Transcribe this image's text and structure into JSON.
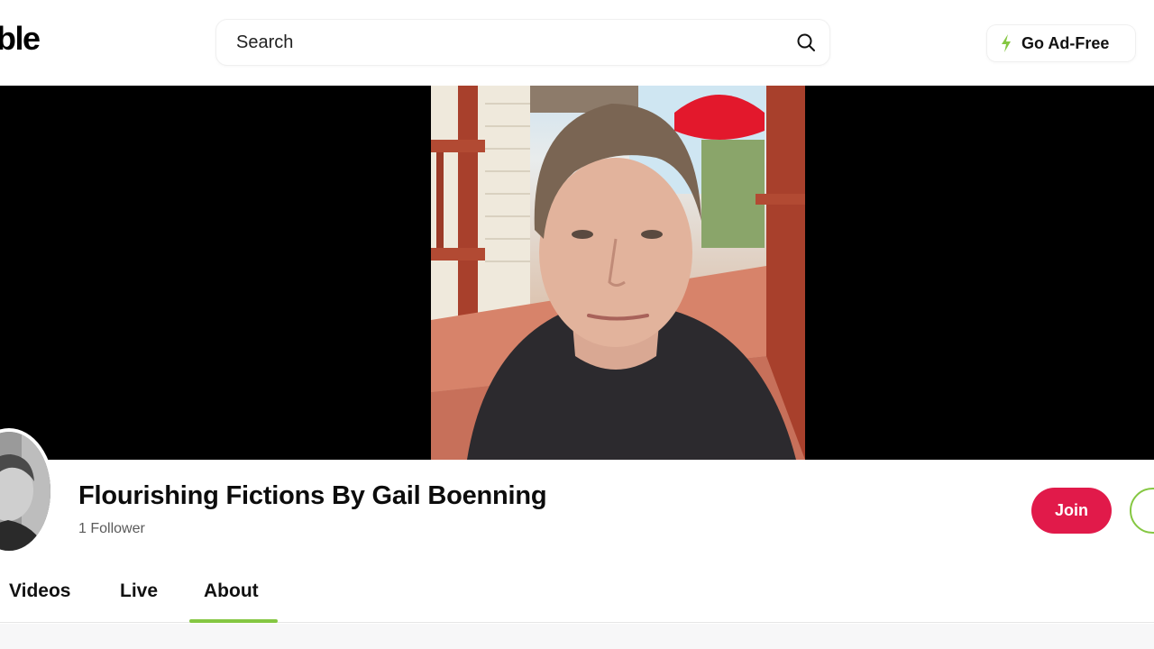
{
  "header": {
    "logo_text": "ble",
    "search": {
      "placeholder": "Search"
    },
    "go_ad_free_label": "Go Ad-Free"
  },
  "channel": {
    "name": "Flourishing Fictions By Gail Boenning",
    "followers": "1 Follower",
    "join_label": "Join"
  },
  "tabs": [
    {
      "label": "Videos",
      "active": false
    },
    {
      "label": "Live",
      "active": false
    },
    {
      "label": "About",
      "active": true
    }
  ],
  "colors": {
    "join": "#e11a4a",
    "accent_green": "#85c742",
    "banner_background": "#000000"
  },
  "icons": {
    "search": "search-icon",
    "ad_free": "lightning-icon"
  }
}
